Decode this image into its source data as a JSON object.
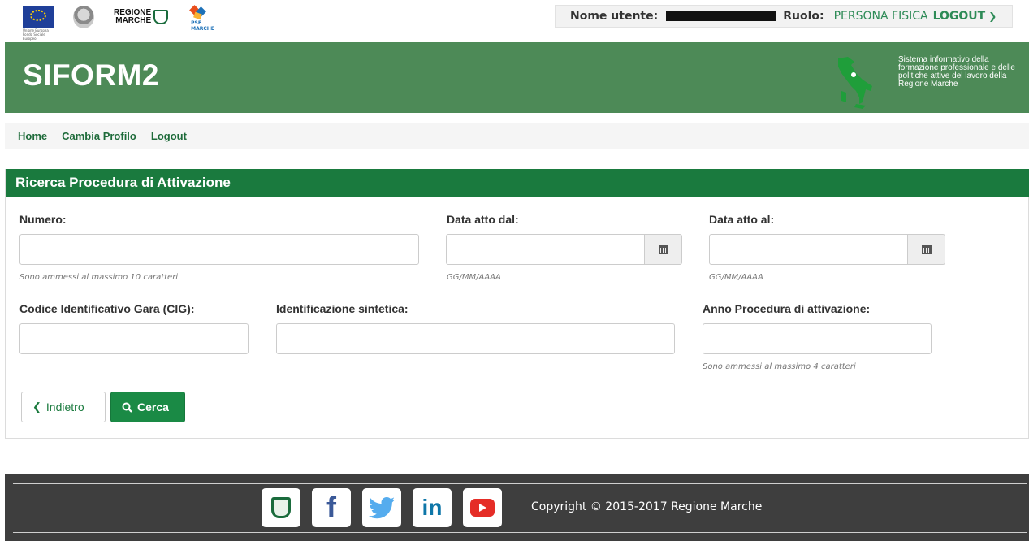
{
  "topbar": {
    "logos": {
      "eu_caption": "Unione Europea Fondo Sociale Europeo",
      "regione_line1": "REGIONE",
      "regione_line2": "MARCHE",
      "pse_text": "PSE MARCHE"
    },
    "user_label": "Nome utente:",
    "role_label": "Ruolo:",
    "role_value": "PERSONA FISICA",
    "logout_label": "LOGOUT"
  },
  "header": {
    "title": "SIFORM2",
    "description": "Sistema informativo della formazione professionale e delle politiche attive del lavoro della Regione Marche"
  },
  "nav": {
    "items": [
      {
        "label": "Home"
      },
      {
        "label": "Cambia Profilo"
      },
      {
        "label": "Logout"
      }
    ]
  },
  "panel": {
    "title": "Ricerca Procedura di Attivazione",
    "fields": {
      "numero": {
        "label": "Numero:",
        "value": "",
        "help": "Sono ammessi al massimo 10 caratteri"
      },
      "data_dal": {
        "label": "Data atto dal:",
        "value": "",
        "help": "GG/MM/AAAA"
      },
      "data_al": {
        "label": "Data atto al:",
        "value": "",
        "help": "GG/MM/AAAA"
      },
      "cig": {
        "label": "Codice Identificativo Gara (CIG):",
        "value": ""
      },
      "identificazione": {
        "label": "Identificazione sintetica:",
        "value": ""
      },
      "anno": {
        "label": "Anno Procedura di attivazione:",
        "value": "",
        "help": "Sono ammessi al massimo 4 caratteri"
      }
    },
    "buttons": {
      "back": "Indietro",
      "search": "Cerca"
    }
  },
  "footer": {
    "copyright": "Copyright © 2015-2017 Regione Marche",
    "social": [
      "regione-marche",
      "facebook",
      "twitter",
      "linkedin",
      "youtube"
    ]
  },
  "colors": {
    "header_green": "#4d8a57",
    "panel_green": "#1a7a3e",
    "link_green": "#2e8b57",
    "footer_bg": "#3e3e3e"
  }
}
